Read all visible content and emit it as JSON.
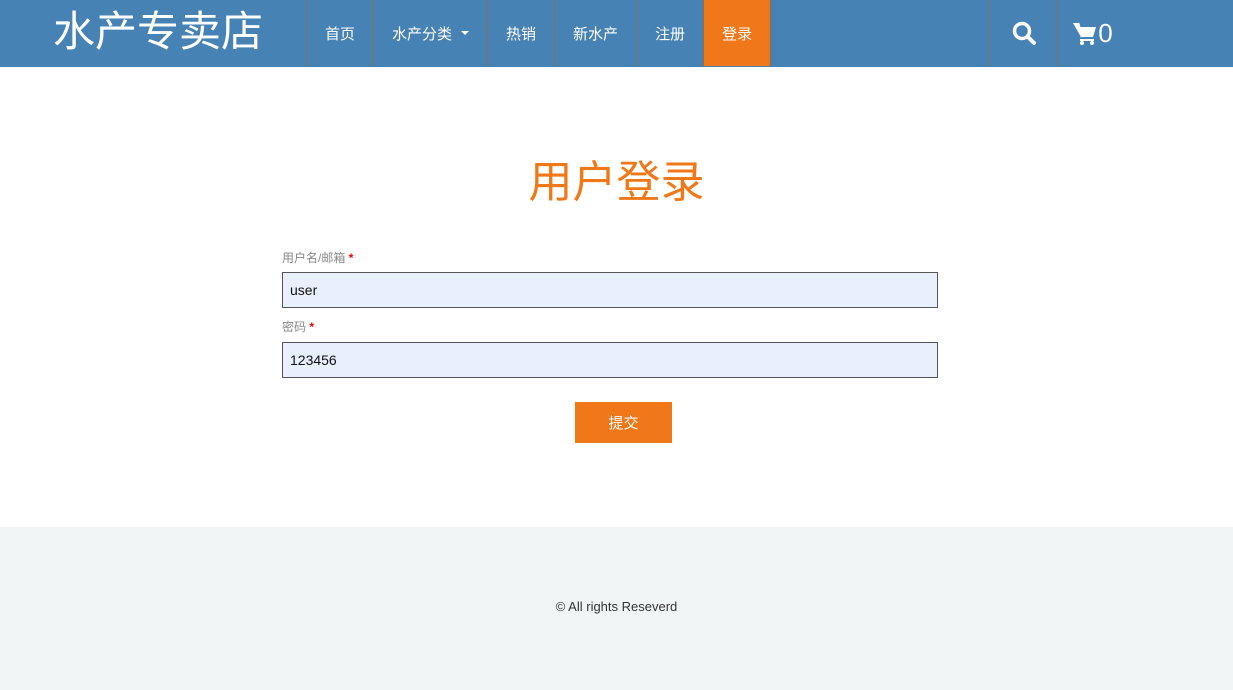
{
  "header": {
    "logo": "水产专卖店",
    "menu": [
      {
        "label": "首页"
      },
      {
        "label": "水产分类"
      },
      {
        "label": "热销"
      },
      {
        "label": "新水产"
      },
      {
        "label": "注册"
      },
      {
        "label": "登录"
      }
    ],
    "cart_count": "0"
  },
  "form": {
    "title": "用户登录",
    "username_label": "用户名/邮箱",
    "username_value": "user",
    "password_label": "密码",
    "password_value": "123456",
    "required_mark": "*",
    "submit": "提交"
  },
  "footer": {
    "copyright": "© All rights Reseverd"
  },
  "colors": {
    "nav": "#4682b4",
    "accent": "#f07818"
  }
}
